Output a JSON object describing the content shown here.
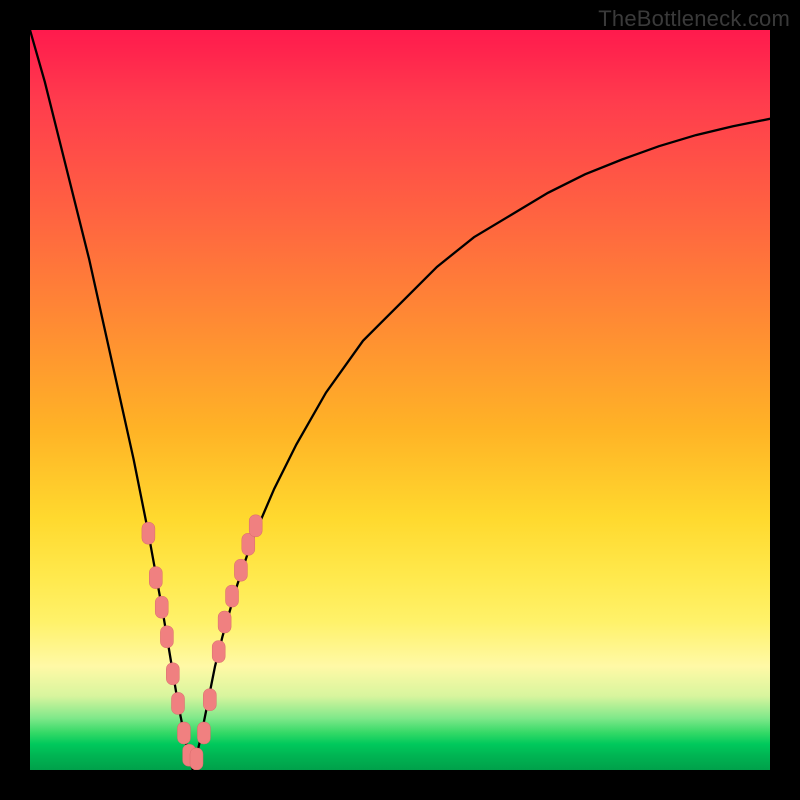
{
  "watermark": "TheBottleneck.com",
  "colors": {
    "frame": "#000000",
    "curve": "#000000",
    "marker_fill": "#f08080",
    "marker_stroke": "#d86b6b"
  },
  "chart_data": {
    "type": "line",
    "title": "",
    "xlabel": "",
    "ylabel": "",
    "xlim": [
      0,
      100
    ],
    "ylim": [
      0,
      100
    ],
    "grid": false,
    "legend": false,
    "x_optimum": 22,
    "series": [
      {
        "name": "bottleneck-curve",
        "x": [
          0,
          2,
          4,
          6,
          8,
          10,
          12,
          14,
          16,
          18,
          19,
          20,
          21,
          22,
          23,
          24,
          25,
          26,
          28,
          30,
          33,
          36,
          40,
          45,
          50,
          55,
          60,
          65,
          70,
          75,
          80,
          85,
          90,
          95,
          100
        ],
        "y": [
          100,
          93,
          85,
          77,
          69,
          60,
          51,
          42,
          32,
          21,
          15,
          9,
          4,
          0,
          4,
          9,
          14,
          18,
          25,
          31,
          38,
          44,
          51,
          58,
          63,
          68,
          72,
          75,
          78,
          80.5,
          82.5,
          84.3,
          85.8,
          87,
          88
        ]
      }
    ],
    "markers": {
      "name": "highlighted-data-points",
      "shape": "rounded-rect",
      "points": [
        {
          "x": 16.0,
          "y": 32.0
        },
        {
          "x": 17.0,
          "y": 26.0
        },
        {
          "x": 17.8,
          "y": 22.0
        },
        {
          "x": 18.5,
          "y": 18.0
        },
        {
          "x": 19.3,
          "y": 13.0
        },
        {
          "x": 20.0,
          "y": 9.0
        },
        {
          "x": 20.8,
          "y": 5.0
        },
        {
          "x": 21.5,
          "y": 2.0
        },
        {
          "x": 22.5,
          "y": 1.5
        },
        {
          "x": 23.5,
          "y": 5.0
        },
        {
          "x": 24.3,
          "y": 9.5
        },
        {
          "x": 25.5,
          "y": 16.0
        },
        {
          "x": 26.3,
          "y": 20.0
        },
        {
          "x": 27.3,
          "y": 23.5
        },
        {
          "x": 28.5,
          "y": 27.0
        },
        {
          "x": 29.5,
          "y": 30.5
        },
        {
          "x": 30.5,
          "y": 33.0
        }
      ]
    }
  }
}
